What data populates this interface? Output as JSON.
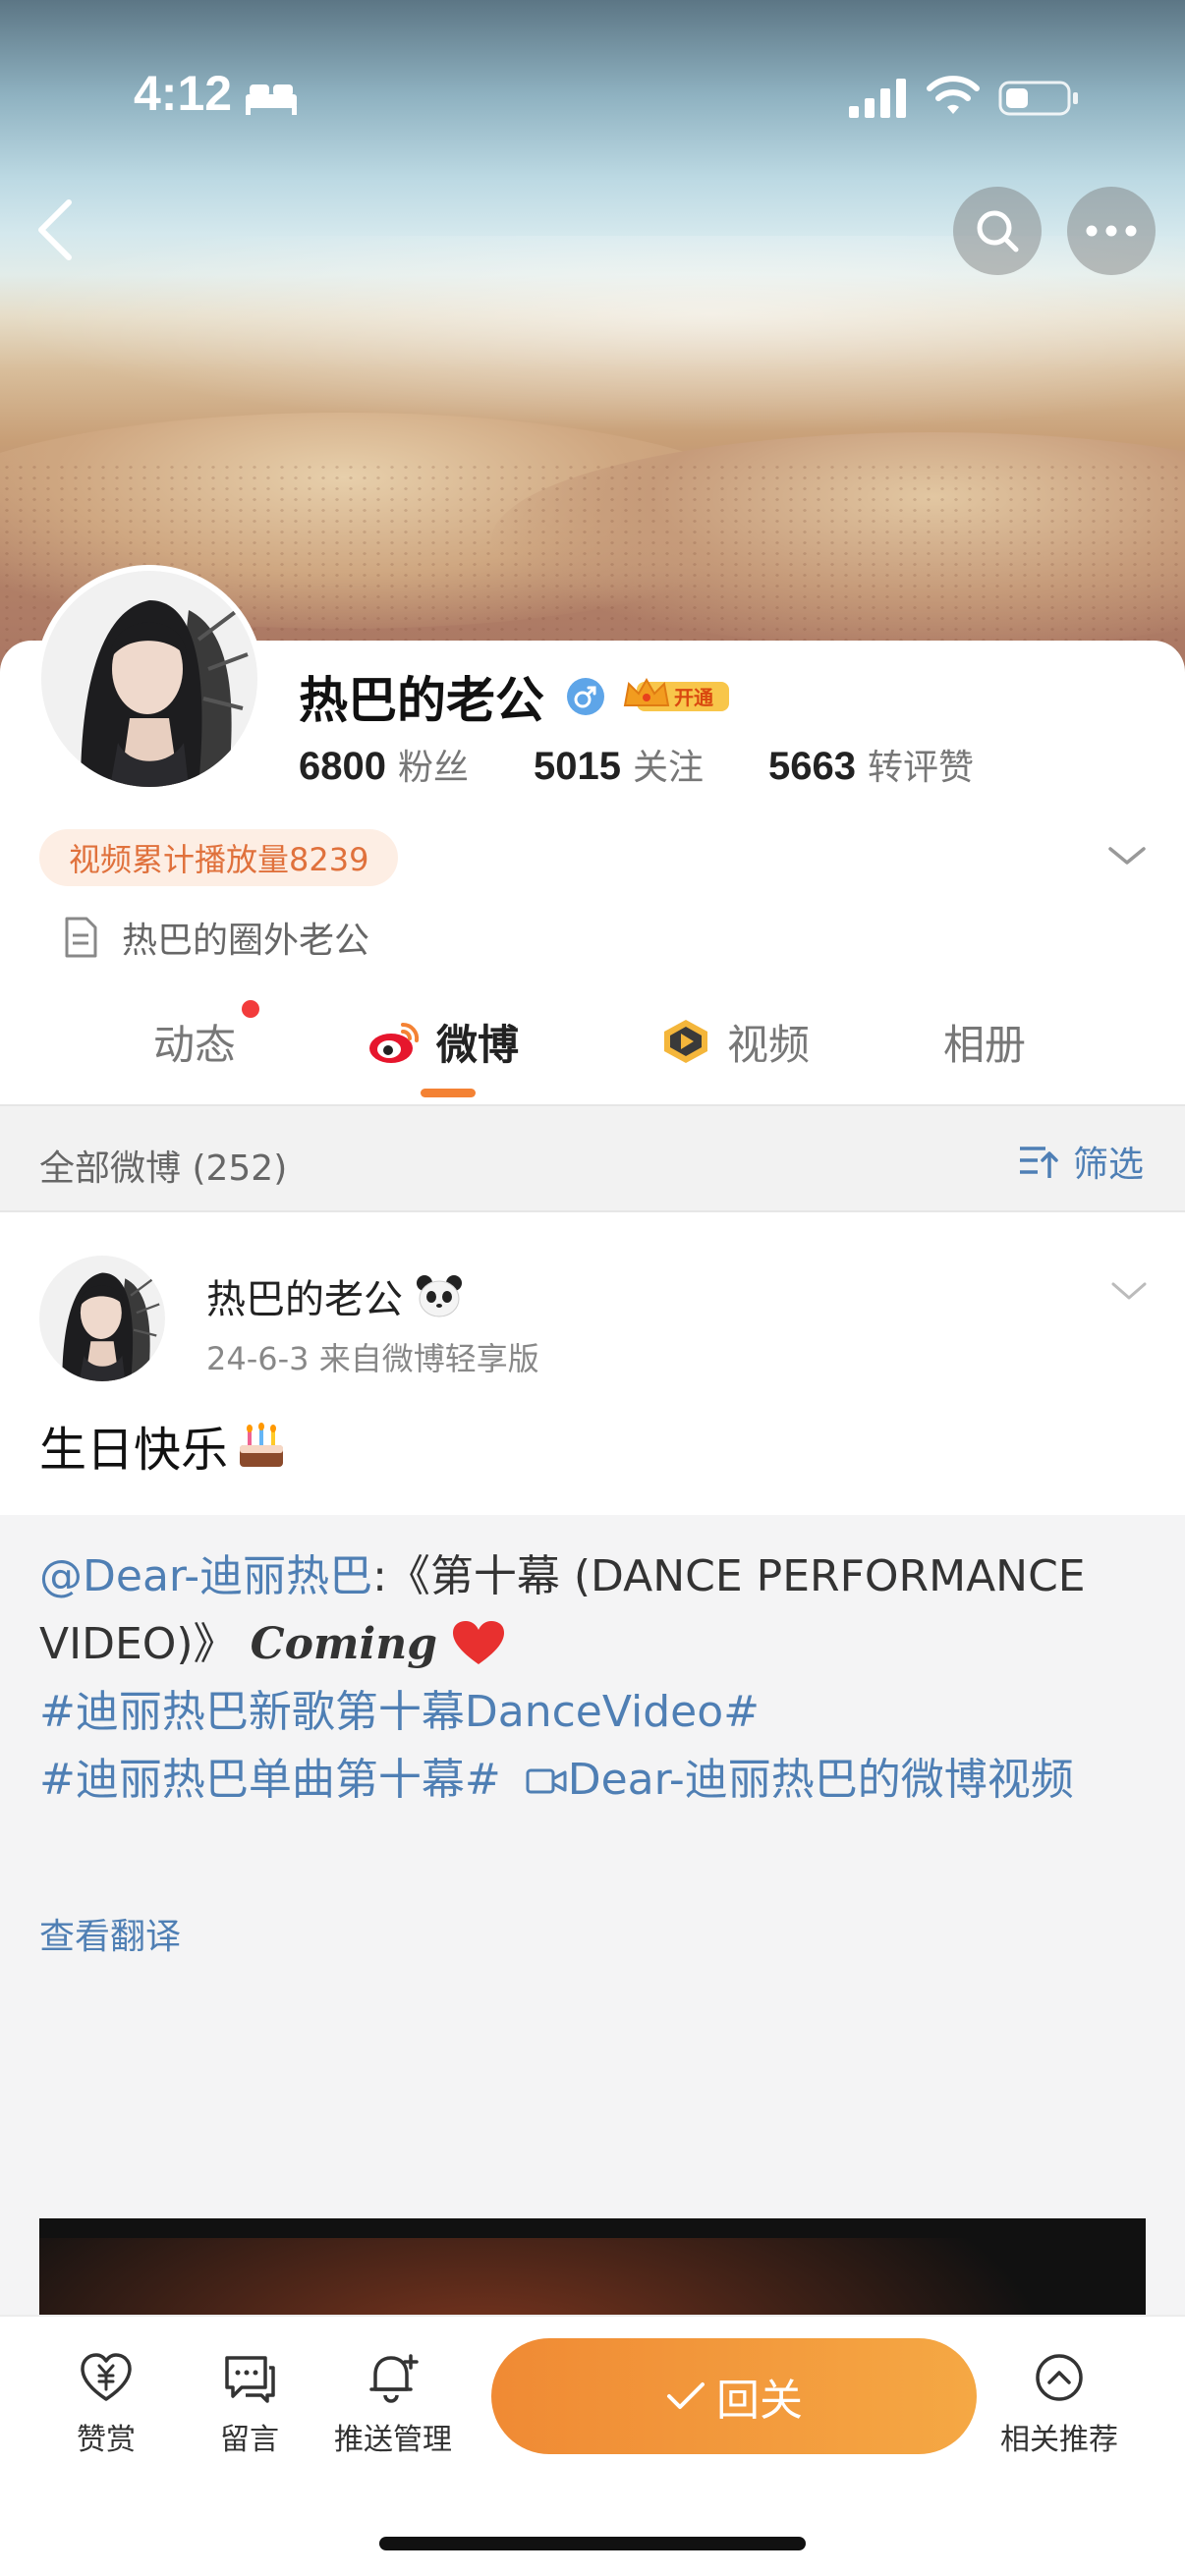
{
  "status_bar": {
    "time": "4:12"
  },
  "profile": {
    "name": "热巴的老公",
    "vip_label": "开通",
    "stats": [
      {
        "value": "6800",
        "label": "粉丝"
      },
      {
        "value": "5015",
        "label": "关注"
      },
      {
        "value": "5663",
        "label": "转评赞"
      }
    ],
    "video_plays": "视频累计播放量8239",
    "bio": "热巴的圈外老公"
  },
  "tabs": [
    {
      "label": "动态"
    },
    {
      "label": "微博"
    },
    {
      "label": "视频"
    },
    {
      "label": "相册"
    }
  ],
  "filter": {
    "all_label": "全部微博 (252)",
    "filter_label": "筛选"
  },
  "post": {
    "author": "热巴的老公",
    "meta": "24-6-3  来自微博轻享版",
    "text": "生日快乐",
    "repost": {
      "mention": "@Dear-迪丽热巴",
      "title_text": ":《第十幕 (DANCE PERFORMANCE VIDEO)》",
      "coming": "Coming",
      "hashtag1": "#迪丽热巴新歌第十幕DanceVideo#",
      "hashtag2": "#迪丽热巴单曲第十幕#",
      "video_link": "Dear-迪丽热巴的微博视频",
      "translate": "查看翻译"
    }
  },
  "bottom_bar": {
    "reward": "赞赏",
    "message": "留言",
    "push": "推送管理",
    "follow": "回关",
    "related": "相关推荐"
  },
  "colors": {
    "accent": "#f48234",
    "link": "#4f7fb4",
    "follow_gradient_start": "#f08a34",
    "follow_gradient_end": "#f5a844"
  }
}
